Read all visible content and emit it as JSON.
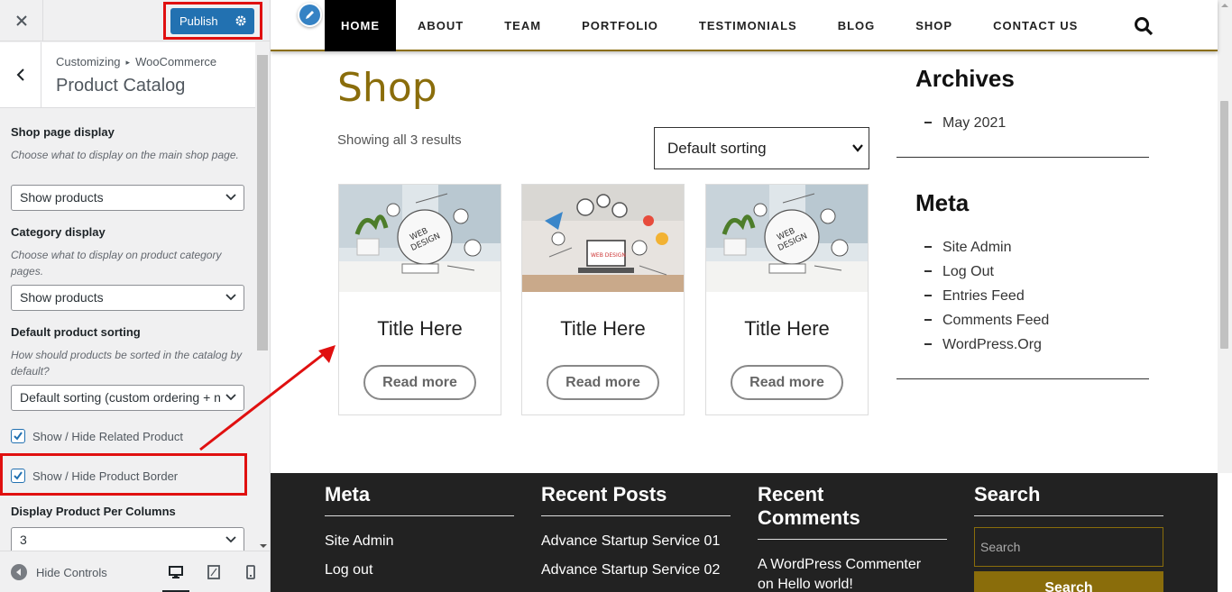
{
  "sidebar": {
    "header": {
      "publish_label": "Publish"
    },
    "section": {
      "breadcrumb_root": "Customizing",
      "breadcrumb_sep": "▸",
      "breadcrumb_parent": "WooCommerce",
      "title": "Product Catalog"
    },
    "controls": {
      "shop_display": {
        "title": "Shop page display",
        "description": "Choose what to display on the main shop page.",
        "value": "Show products"
      },
      "category_display": {
        "title": "Category display",
        "description": "Choose what to display on product category pages.",
        "value": "Show products"
      },
      "default_sorting": {
        "title": "Default product sorting",
        "description": "How should products be sorted in the catalog by default?",
        "value": "Default sorting (custom ordering + n"
      },
      "related_product": {
        "label": "Show / Hide Related Product",
        "checked": true
      },
      "product_border": {
        "label": "Show / Hide Product Border",
        "checked": true
      },
      "per_columns": {
        "title": "Display Product Per Columns",
        "value": "3"
      }
    },
    "footer": {
      "hide_controls_label": "Hide Controls"
    }
  },
  "preview": {
    "nav": {
      "items": [
        "HOME",
        "ABOUT",
        "TEAM",
        "PORTFOLIO",
        "TESTIMONIALS",
        "BLOG",
        "SHOP",
        "CONTACT US"
      ],
      "active": "HOME"
    },
    "shop": {
      "title": "Shop",
      "result_count": "Showing all 3 results",
      "sort_value": "Default sorting",
      "products": [
        {
          "title": "Title Here",
          "button": "Read more"
        },
        {
          "title": "Title Here",
          "button": "Read more"
        },
        {
          "title": "Title Here",
          "button": "Read more"
        }
      ]
    },
    "widgets": {
      "archives": {
        "title": "Archives",
        "items": [
          "May 2021"
        ]
      },
      "meta": {
        "title": "Meta",
        "items": [
          "Site Admin",
          "Log Out",
          "Entries Feed",
          "Comments Feed",
          "WordPress.Org"
        ]
      }
    },
    "footer": {
      "meta": {
        "title": "Meta",
        "links": [
          "Site Admin",
          "Log out"
        ]
      },
      "recent_posts": {
        "title": "Recent Posts",
        "links": [
          "Advance Startup Service 01",
          "Advance Startup Service 02"
        ]
      },
      "recent_comments": {
        "title_line1": "Recent",
        "title_line2": "Comments",
        "links": [
          "A WordPress Commenter",
          "on Hello world!"
        ]
      },
      "search": {
        "title": "Search",
        "placeholder": "Search",
        "button": "Search"
      }
    }
  },
  "colors": {
    "accent": "#8a6d0b",
    "publish": "#2271b1",
    "highlight": "#e01010",
    "footer_bg": "#222222"
  }
}
